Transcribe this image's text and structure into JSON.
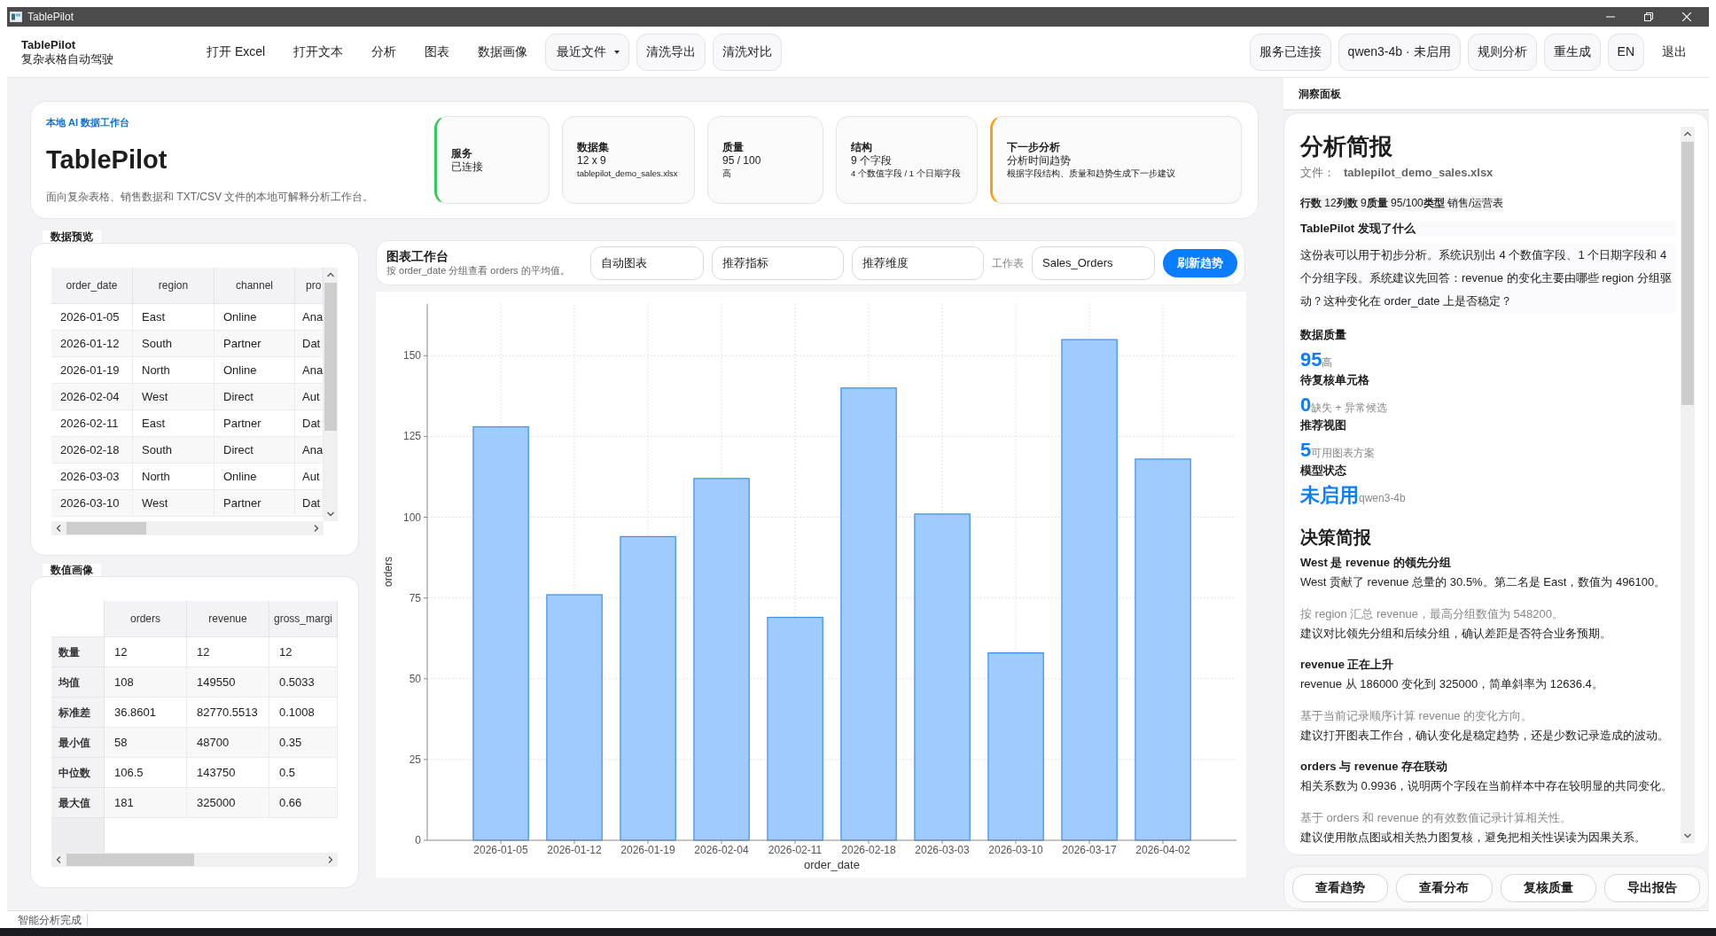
{
  "window": {
    "title": "TablePilot"
  },
  "menu_bar": {
    "app_name": "TablePilot",
    "app_subtitle": "复杂表格自动驾驶",
    "items": [
      {
        "label": "打开 Excel",
        "kind": "plain"
      },
      {
        "label": "打开文本",
        "kind": "plain"
      },
      {
        "label": "分析",
        "kind": "plain"
      },
      {
        "label": "图表",
        "kind": "plain"
      },
      {
        "label": "数据画像",
        "kind": "plain"
      },
      {
        "label": "最近文件",
        "kind": "dropdown"
      },
      {
        "label": "清洗导出",
        "kind": "outlined"
      },
      {
        "label": "清洗对比",
        "kind": "outlined"
      }
    ],
    "right_items": [
      {
        "label": "服务已连接",
        "kind": "outlined"
      },
      {
        "label": "qwen3-4b · 未启用",
        "kind": "outlined"
      },
      {
        "label": "规则分析",
        "kind": "outlined"
      },
      {
        "label": "重生成",
        "kind": "outlined"
      },
      {
        "label": "EN",
        "kind": "outlined"
      },
      {
        "label": "退出",
        "kind": "plain"
      }
    ]
  },
  "header": {
    "eyebrow": "本地 AI 数据工作台",
    "title": "TablePilot",
    "subtitle": "面向复杂表格、销售数据和 TXT/CSV 文件的本地可解释分析工作台。",
    "cards": [
      {
        "title": "服务",
        "value": "已连接",
        "color": "#34c759"
      },
      {
        "title": "数据集",
        "value": "12 x 9",
        "detail": "tablepilot_demo_sales.xlsx"
      },
      {
        "title": "质量",
        "value": "95 / 100",
        "detail": "高"
      },
      {
        "title": "结构",
        "value": "9 个字段",
        "detail": "4 个数值字段 / 1 个日期字段"
      },
      {
        "title": "下一步分析",
        "value": "分析时间趋势",
        "detail": "根据字段结构、质量和趋势生成下一步建议",
        "color": "#ff9f0a"
      }
    ]
  },
  "data_preview": {
    "title": "数据预览",
    "columns": [
      "order_date",
      "region",
      "channel",
      "pro"
    ],
    "rows": [
      [
        "2026-01-05",
        "East",
        "Online",
        "Ana"
      ],
      [
        "2026-01-12",
        "South",
        "Partner",
        "Dat"
      ],
      [
        "2026-01-19",
        "North",
        "Online",
        "Ana"
      ],
      [
        "2026-02-04",
        "West",
        "Direct",
        "Aut"
      ],
      [
        "2026-02-11",
        "East",
        "Partner",
        "Dat"
      ],
      [
        "2026-02-18",
        "South",
        "Direct",
        "Ana"
      ],
      [
        "2026-03-03",
        "North",
        "Online",
        "Aut"
      ],
      [
        "2026-03-10",
        "West",
        "Partner",
        "Dat"
      ]
    ]
  },
  "numeric_profile": {
    "title": "数值画像",
    "columns": [
      "orders",
      "revenue",
      "gross_margi"
    ],
    "rows": [
      {
        "label": "数量",
        "values": [
          "12",
          "12",
          "12"
        ]
      },
      {
        "label": "均值",
        "values": [
          "108",
          "149550",
          "0.5033"
        ]
      },
      {
        "label": "标准差",
        "values": [
          "36.8601",
          "82770.5513",
          "0.1008"
        ]
      },
      {
        "label": "最小值",
        "values": [
          "58",
          "48700",
          "0.35"
        ]
      },
      {
        "label": "中位数",
        "values": [
          "106.5",
          "143750",
          "0.5"
        ]
      },
      {
        "label": "最大值",
        "values": [
          "181",
          "325000",
          "0.66"
        ]
      }
    ]
  },
  "chart_workbench": {
    "title": "图表工作台",
    "subtitle": "按 order_date 分组查看 orders 的平均值。",
    "chart_type": "自动图表",
    "metric": "推荐指标",
    "dimension": "推荐维度",
    "sheet_label": "工作表",
    "sheet": "Sales_Orders",
    "refresh_button": "刷新趋势",
    "chart_data": {
      "type": "bar",
      "xlabel": "order_date",
      "ylabel": "orders",
      "categories": [
        "2026-01-05",
        "2026-01-12",
        "2026-01-19",
        "2026-02-04",
        "2026-02-11",
        "2026-02-18",
        "2026-03-03",
        "2026-03-10",
        "2026-03-17",
        "2026-04-02"
      ],
      "series": [
        {
          "color": "#9fcbff",
          "values": [
            128,
            76,
            94,
            112,
            69,
            140,
            101,
            58,
            155,
            118
          ]
        }
      ],
      "ylim": [
        0,
        166
      ],
      "yticks": [
        0,
        25,
        50,
        75,
        100,
        125,
        150
      ],
      "grid": true
    }
  },
  "insight_panel": {
    "title": "洞察面板",
    "heading": "分析简报",
    "file_label": "文件：",
    "file_name": "tablepilot_demo_sales.xlsx",
    "stats": "**行数** 12**列数** 9**质量** 95/100**类型** 销售/运营表",
    "discovery_title": "TablePilot 发现了什么",
    "discovery_text": "这份表可以用于初步分析。系统识别出 4 个数值字段、1 个日期字段和 4 个分组字段。系统建议先回答：revenue 的变化主要由哪些 region 分组驱动？这种变化在 order_date 上是否稳定？",
    "metrics": [
      {
        "label": "数据质量",
        "value": "95",
        "note": "高"
      },
      {
        "label": "待复核单元格",
        "value": "0",
        "note": "缺失 + 异常候选"
      },
      {
        "label": "推荐视图",
        "value": "5",
        "note": "可用图表方案"
      },
      {
        "label": "模型状态",
        "value": "未启用",
        "note": "qwen3-4b"
      }
    ],
    "decision_title": "决策简报",
    "decisions": [
      {
        "title": "West 是 revenue 的领先分组",
        "finding": "West 贡献了 revenue 总量的 30.5%。第二名是 East，数值为 496100。",
        "basis": "按 region 汇总 revenue，最高分组数值为 548200。",
        "advice": "建议对比领先分组和后续分组，确认差距是否符合业务预期。"
      },
      {
        "title": "revenue 正在上升",
        "finding": "revenue 从 186000 变化到 325000，简单斜率为 12636.4。",
        "basis": "基于当前记录顺序计算 revenue 的变化方向。",
        "advice": "建议打开图表工作台，确认变化是稳定趋势，还是少数记录造成的波动。"
      },
      {
        "title": "orders 与 revenue 存在联动",
        "finding": "相关系数为 0.9936，说明两个字段在当前样本中存在较明显的共同变化。",
        "basis": "基于 orders 和 revenue 的有效数值记录计算相关性。",
        "advice": "建议使用散点图或相关热力图复核，避免把相关性误读为因果关系。"
      }
    ],
    "actions": [
      "查看趋势",
      "查看分布",
      "复核质量",
      "导出报告"
    ]
  },
  "status_bar": {
    "text": "智能分析完成"
  }
}
